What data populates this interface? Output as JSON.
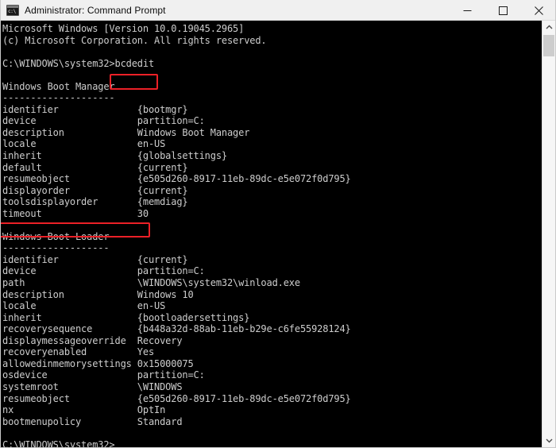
{
  "window": {
    "title": "Administrator: Command Prompt",
    "icon": "command-prompt-icon",
    "controls": {
      "minimize": "Minimize",
      "maximize": "Maximize",
      "close": "Close"
    }
  },
  "console": {
    "background_color": "#000000",
    "text_color": "#cdcdcd",
    "content": "Microsoft Windows [Version 10.0.19045.2965]\n(c) Microsoft Corporation. All rights reserved.\n\nC:\\WINDOWS\\system32>bcdedit\n\nWindows Boot Manager\n--------------------\nidentifier              {bootmgr}\ndevice                  partition=C:\ndescription             Windows Boot Manager\nlocale                  en-US\ninherit                 {globalsettings}\ndefault                 {current}\nresumeobject            {e505d260-8917-11eb-89dc-e5e072f0d795}\ndisplayorder            {current}\ntoolsdisplayorder       {memdiag}\ntimeout                 30\n\nWindows Boot Loader\n-------------------\nidentifier              {current}\ndevice                  partition=C:\npath                    \\WINDOWS\\system32\\winload.exe\ndescription             Windows 10\nlocale                  en-US\ninherit                 {bootloadersettings}\nrecoverysequence        {b448a32d-88ab-11eb-b29e-c6fe55928124}\ndisplaymessageoverride  Recovery\nrecoveryenabled         Yes\nallowedinmemorysettings 0x15000075\nosdevice                partition=C:\nsystemroot              \\WINDOWS\nresumeobject            {e505d260-8917-11eb-89dc-e5e072f0d795}\nnx                      OptIn\nbootmenupolicy          Standard\n\nC:\\WINDOWS\\system32>",
    "lines": {
      "version_banner": "Microsoft Windows [Version 10.0.19045.2965]",
      "copyright": "(c) Microsoft Corporation. All rights reserved.",
      "prompt_with_command": "C:\\WINDOWS\\system32>bcdedit",
      "final_prompt": "C:\\WINDOWS\\system32>"
    },
    "command_entered": "bcdedit",
    "sections": [
      {
        "heading": "Windows Boot Manager",
        "underline": "--------------------",
        "entries": [
          {
            "key": "identifier",
            "value": "{bootmgr}"
          },
          {
            "key": "device",
            "value": "partition=C:"
          },
          {
            "key": "description",
            "value": "Windows Boot Manager"
          },
          {
            "key": "locale",
            "value": "en-US"
          },
          {
            "key": "inherit",
            "value": "{globalsettings}"
          },
          {
            "key": "default",
            "value": "{current}"
          },
          {
            "key": "resumeobject",
            "value": "{e505d260-8917-11eb-89dc-e5e072f0d795}"
          },
          {
            "key": "displayorder",
            "value": "{current}"
          },
          {
            "key": "toolsdisplayorder",
            "value": "{memdiag}"
          },
          {
            "key": "timeout",
            "value": "30"
          }
        ]
      },
      {
        "heading": "Windows Boot Loader",
        "underline": "-------------------",
        "entries": [
          {
            "key": "identifier",
            "value": "{current}"
          },
          {
            "key": "device",
            "value": "partition=C:"
          },
          {
            "key": "path",
            "value": "\\WINDOWS\\system32\\winload.exe"
          },
          {
            "key": "description",
            "value": "Windows 10"
          },
          {
            "key": "locale",
            "value": "en-US"
          },
          {
            "key": "inherit",
            "value": "{bootloadersettings}"
          },
          {
            "key": "recoverysequence",
            "value": "{b448a32d-88ab-11eb-b29e-c6fe55928124}"
          },
          {
            "key": "displaymessageoverride",
            "value": "Recovery"
          },
          {
            "key": "recoveryenabled",
            "value": "Yes"
          },
          {
            "key": "allowedinmemorysettings",
            "value": "0x15000075"
          },
          {
            "key": "osdevice",
            "value": "partition=C:"
          },
          {
            "key": "systemroot",
            "value": "\\WINDOWS"
          },
          {
            "key": "resumeobject",
            "value": "{e505d260-8917-11eb-89dc-e5e072f0d795}"
          },
          {
            "key": "nx",
            "value": "OptIn"
          },
          {
            "key": "bootmenupolicy",
            "value": "Standard"
          }
        ]
      }
    ]
  },
  "annotations": {
    "color": "#ec2027",
    "boxes": [
      {
        "name": "bcdedit-command",
        "target": "bcdedit"
      },
      {
        "name": "timeout-row",
        "target": "timeout                 30"
      }
    ]
  },
  "scrollbar": {
    "up_arrow": "scroll-up",
    "down_arrow": "scroll-down",
    "thumb": "scroll-thumb"
  }
}
